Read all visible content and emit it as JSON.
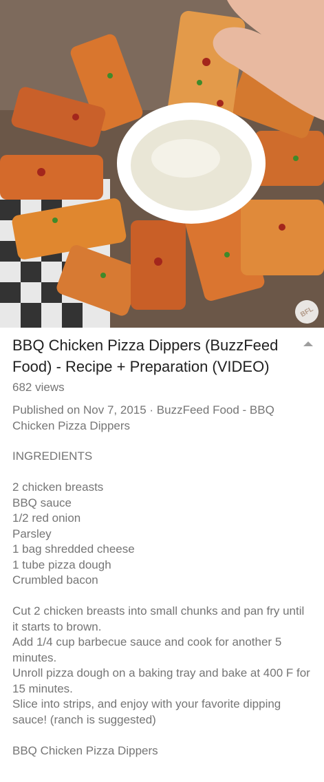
{
  "video": {
    "watermark": "BFL"
  },
  "info": {
    "title": "BBQ Chicken Pizza Dippers (BuzzFeed Food) - Recipe + Preparation (VIDEO)",
    "views": "682 views",
    "published": "Published on Nov 7, 2015 · BuzzFeed Food - BBQ Chicken Pizza Dippers",
    "ingredients_heading": "INGREDIENTS",
    "ingredients": [
      "2 chicken breasts",
      "BBQ sauce",
      "1/2 red onion",
      "Parsley",
      "1 bag shredded cheese",
      "1 tube pizza dough",
      "Crumbled bacon"
    ],
    "steps": [
      "Cut 2 chicken breasts into small chunks and pan fry until it starts to brown.",
      "Add 1/4 cup barbecue sauce and cook for another 5 minutes.",
      "Unroll pizza dough on a baking tray and bake at 400 F for 15 minutes.",
      "Slice into strips, and enjoy with your favorite dipping sauce! (ranch is suggested)"
    ],
    "footer_text": "BBQ Chicken Pizza Dippers"
  }
}
